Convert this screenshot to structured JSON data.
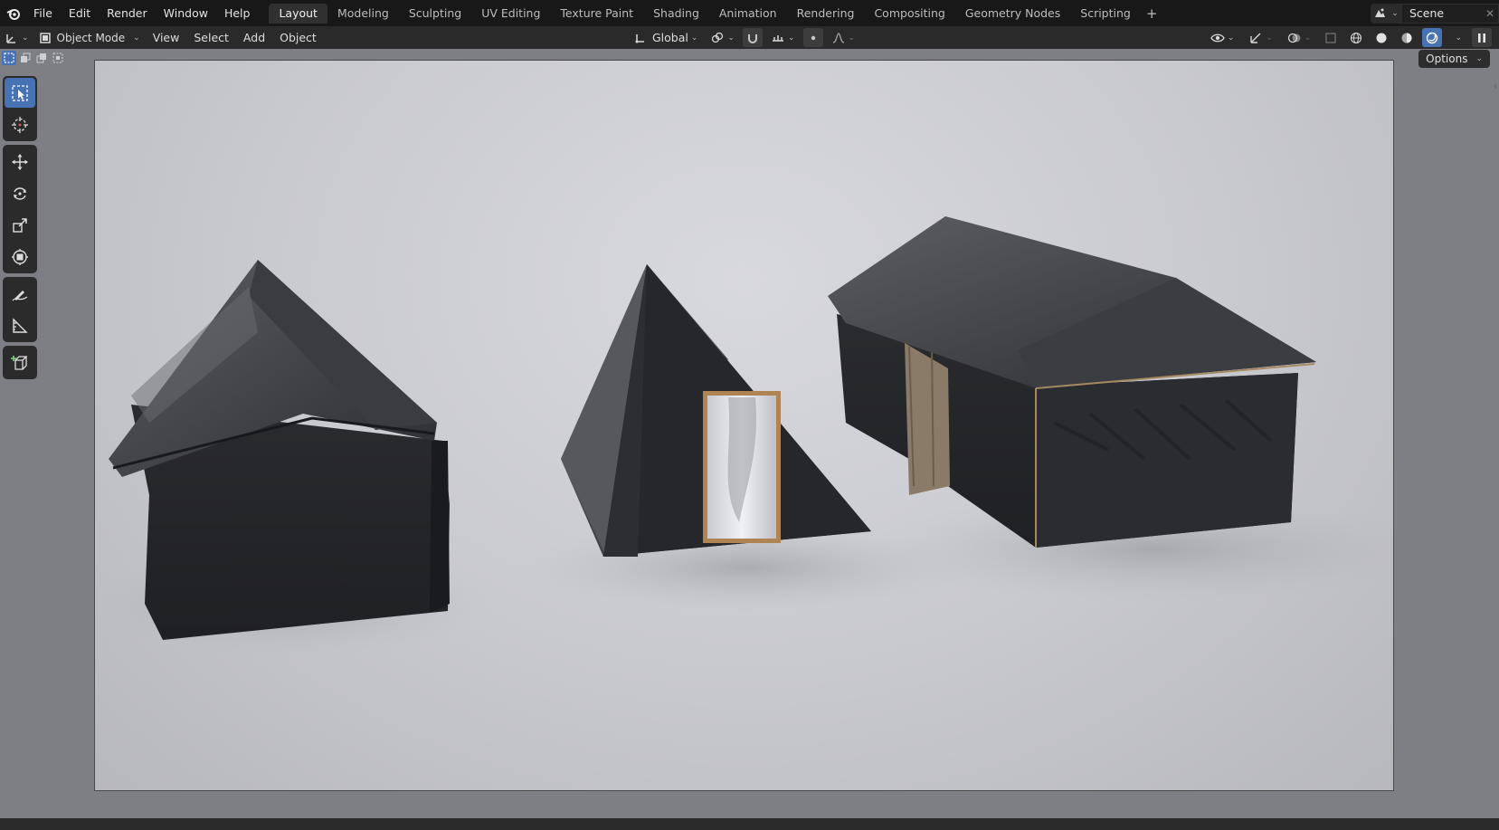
{
  "menus": [
    "File",
    "Edit",
    "Render",
    "Window",
    "Help"
  ],
  "workspaces": [
    "Layout",
    "Modeling",
    "Sculpting",
    "UV Editing",
    "Texture Paint",
    "Shading",
    "Animation",
    "Rendering",
    "Compositing",
    "Geometry Nodes",
    "Scripting"
  ],
  "active_workspace": "Layout",
  "scene": {
    "name": "Scene"
  },
  "header": {
    "mode": "Object Mode",
    "view": "View",
    "select": "Select",
    "add": "Add",
    "object": "Object",
    "transform_orientation": "Global"
  },
  "viewport": {
    "options_label": "Options",
    "shading": "rendered",
    "scene_objects": [
      "gable-tent",
      "a-frame-tent",
      "cabin-tent"
    ]
  },
  "tools": [
    "select-box",
    "cursor",
    "move",
    "rotate",
    "scale",
    "transform",
    "annotate",
    "measure",
    "add-cube"
  ],
  "colors": {
    "accent": "#4772b3",
    "topbar": "#181818",
    "header": "#2a2a2a",
    "viewport_bg": "#7d7f84"
  }
}
